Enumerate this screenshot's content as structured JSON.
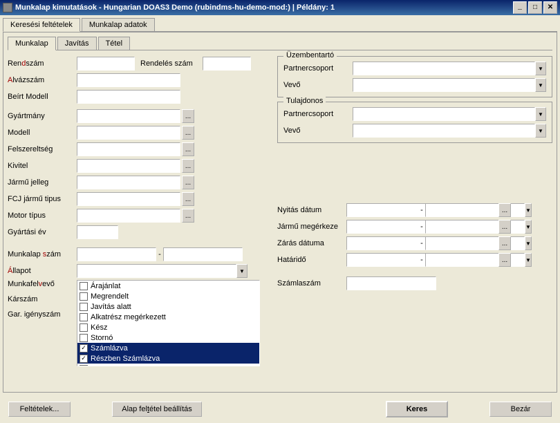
{
  "window": {
    "title": "Munkalap kimutatások - Hungarian DOAS3 Demo (rubindms-hu-demo-mod:) | Példány: 1",
    "minimize": "_",
    "maximize": "□",
    "close": "✕"
  },
  "tabs_outer": {
    "t1": "Keresési feltételek",
    "t2": "Munkalap adatok"
  },
  "tabs_inner": {
    "t1": "Munkalap",
    "t2": "Javítás",
    "t3": "Tétel"
  },
  "left": {
    "rendszam": {
      "pre": "Ren",
      "hot": "d",
      "post": "szám"
    },
    "alvazszam": {
      "pre": "",
      "hot": "A",
      "post": "lvázszám"
    },
    "beirtmodell": "Beírt Modell",
    "gyartmany": "Gyártmány",
    "modell": "Modell",
    "felszereltseg": "Felszereltség",
    "kivitel": "Kivitel",
    "jarmu_jelleg": "Jármű jelleg",
    "fcj": "FCJ jármű tipus",
    "motor": "Motor típus",
    "gyartasi_ev": "Gyártási év",
    "rendeles_szam": "Rendelés szám",
    "munkalap_szam": {
      "pre": "Munkalap ",
      "hot": "s",
      "post": "zám"
    },
    "allapot": {
      "pre": "",
      "hot": "Á",
      "post": "llapot"
    },
    "munkafelvevo": {
      "pre": "Munkafel",
      "hot": "v",
      "post": "evő"
    },
    "karszam": "Kárszám",
    "gar_igenyszam": "Gar. igényszám"
  },
  "listbox": {
    "items": [
      {
        "label": "Árajánlat",
        "checked": false,
        "sel": false
      },
      {
        "label": "Megrendelt",
        "checked": false,
        "sel": false
      },
      {
        "label": "Javítás alatt",
        "checked": false,
        "sel": false
      },
      {
        "label": "Alkatrész megérkezett",
        "checked": false,
        "sel": false
      },
      {
        "label": "Kész",
        "checked": false,
        "sel": false
      },
      {
        "label": "Stornó",
        "checked": false,
        "sel": false
      },
      {
        "label": "Számlázva",
        "checked": true,
        "sel": true
      },
      {
        "label": "Részben Számlázva",
        "checked": true,
        "sel": true
      },
      {
        "label": "Bizonylat nélkül lezárva",
        "checked": false,
        "sel": false
      }
    ]
  },
  "right": {
    "uzembentarto": "Üzembentartó",
    "tulajdonos": "Tulajdonos",
    "partnercsoport": "Partnercsoport",
    "vevo": "Vevő",
    "nyitas": "Nyitás dátum",
    "jarmu_megerkeze": "Jármű megérkeze",
    "zaras": "Zárás dátuma",
    "hatarido": "Határidő",
    "szamlaszam": "Számlaszám"
  },
  "footer": {
    "feltetelek": "Feltételek...",
    "alap": {
      "pre": "Alap fel",
      "hot": "t",
      "post": "étel beállítás"
    },
    "keres": "Keres",
    "bezar": "Bezár"
  },
  "glyph": {
    "down": "▼",
    "dots": "..."
  }
}
